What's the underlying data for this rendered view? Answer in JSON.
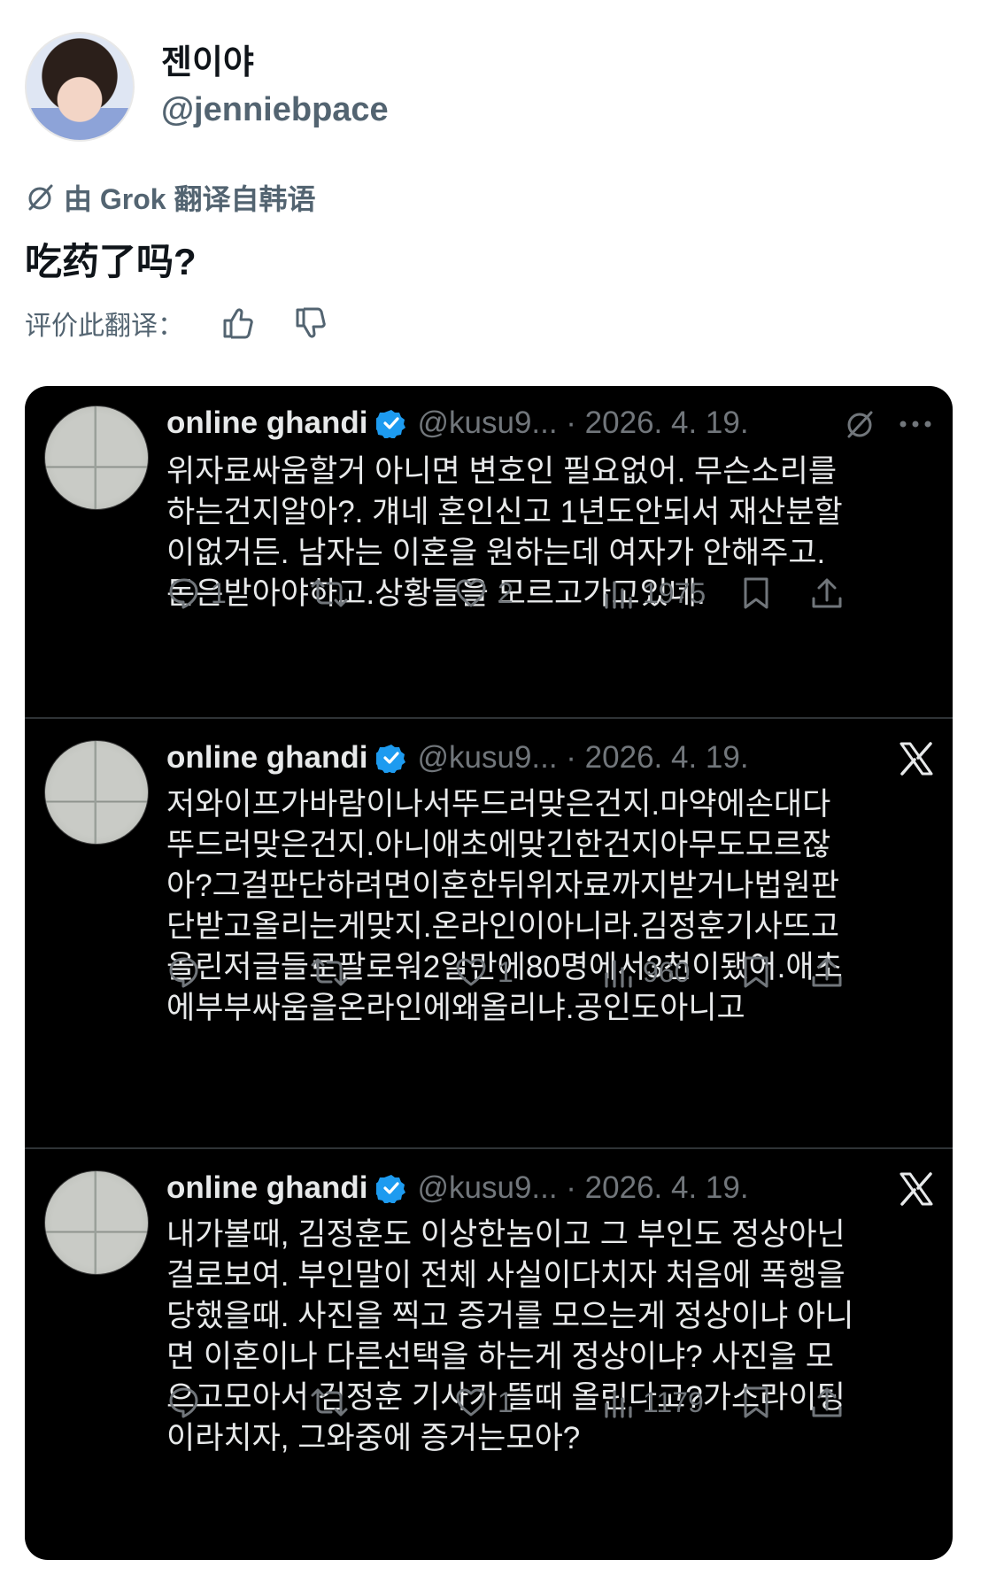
{
  "post": {
    "display_name": "젠이야",
    "handle": "@jenniebpace",
    "translated_by": "由 Grok 翻译自韩语",
    "translated_text": "吃药了吗?",
    "rate_label": "评价此翻译："
  },
  "colors": {
    "embed_bg": "#000000",
    "text_primary": "#e7e9ea",
    "text_secondary": "#71767b",
    "verified": "#1d9bf0"
  },
  "tweets": [
    {
      "name": "online ghandi",
      "meta": "@kusu9... · 2026. 4. 19.",
      "body": "위자료싸움할거 아니면 변호인 필요없어. 무슨소리를하는건지알아?. 걔네 혼인신고 1년도안되서 재산분할이없거든. 남자는 이혼을 원하는데 여자가 안해주고. 돈은받아야하고.상황들을 모르고가고있네.",
      "reply_count": "1",
      "like_count": "2",
      "view_count": "1975",
      "right_icons": [
        "grok-icon",
        "more-icon"
      ]
    },
    {
      "name": "online ghandi",
      "meta": "@kusu9... · 2026. 4. 19.",
      "body": "저와이프가바람이나서뚜드러맞은건지.마약에손대다뚜드러맞은건지.아니애초에맞긴한건지아무도모르잖아?그걸판단하려면이혼한뒤위자료까지받거나법원판단받고올리는게맞지.온라인이아니라.김정훈기사뜨고올린저글들로팔로워2일만에80명에서3천이됐어.애초에부부싸움을온라인에왜올리냐.공인도아니고",
      "reply_count": "",
      "like_count": "1",
      "view_count": "960",
      "right_icons": [
        "x-logo-icon"
      ]
    },
    {
      "name": "online ghandi",
      "meta": "@kusu9... · 2026. 4. 19.",
      "body": "내가볼때, 김정훈도 이상한놈이고 그 부인도 정상아닌걸로보여. 부인말이 전체 사실이다치자 처음에 폭행을 당했을때. 사진을 찍고 증거를 모으는게 정상이냐 아니면 이혼이나 다른선택을 하는게 정상이냐? 사진을 모으고모아서 김정훈 기사가 뜰때 올린다고?가스라이팅이라치자, 그와중에 증거는모아?",
      "reply_count": "",
      "like_count": "1",
      "view_count": "1179",
      "right_icons": [
        "x-logo-icon"
      ]
    }
  ]
}
